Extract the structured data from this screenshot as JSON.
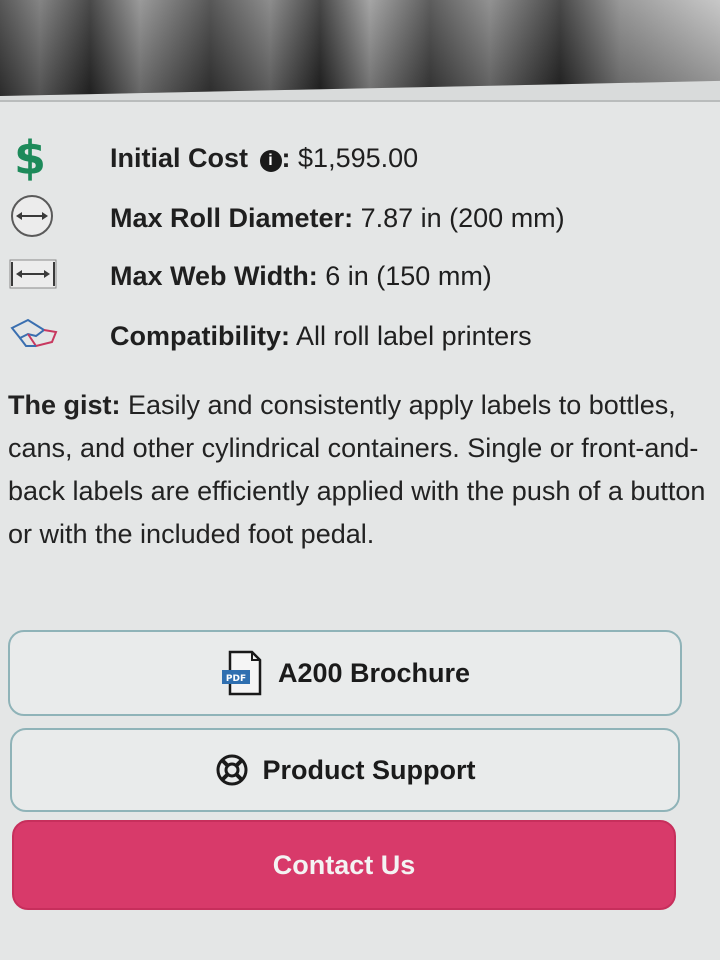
{
  "specs": [
    {
      "icon": "dollar-icon",
      "label": "Initial Cost",
      "info_icon": "i",
      "separator": ":",
      "value": " $1,595.00"
    },
    {
      "icon": "roll-diameter-icon",
      "label": "Max Roll Diameter:",
      "value": " 7.87 in (200 mm)"
    },
    {
      "icon": "web-width-icon",
      "label": "Max Web Width:",
      "value": " 6 in (150 mm)"
    },
    {
      "icon": "compatibility-icon",
      "label": "Compatibility:",
      "value": " All roll label printers"
    }
  ],
  "gist": {
    "label": "The gist:",
    "text": " Easily and consistently apply labels to bottles, cans, and other cylindrical containers. Single or front-and-back labels are efficiently applied with the push of a button or with the included foot pedal."
  },
  "buttons": {
    "brochure": {
      "label": "A200 Brochure",
      "icon": "pdf-icon",
      "icon_text": "PDF"
    },
    "support": {
      "label": "Product Support",
      "icon": "lifebuoy-icon"
    },
    "contact": {
      "label": "Contact Us"
    }
  },
  "colors": {
    "dollar": "#1d8a5a",
    "primary_button": "#d83a6a",
    "outline_border": "#8fb3b8"
  }
}
